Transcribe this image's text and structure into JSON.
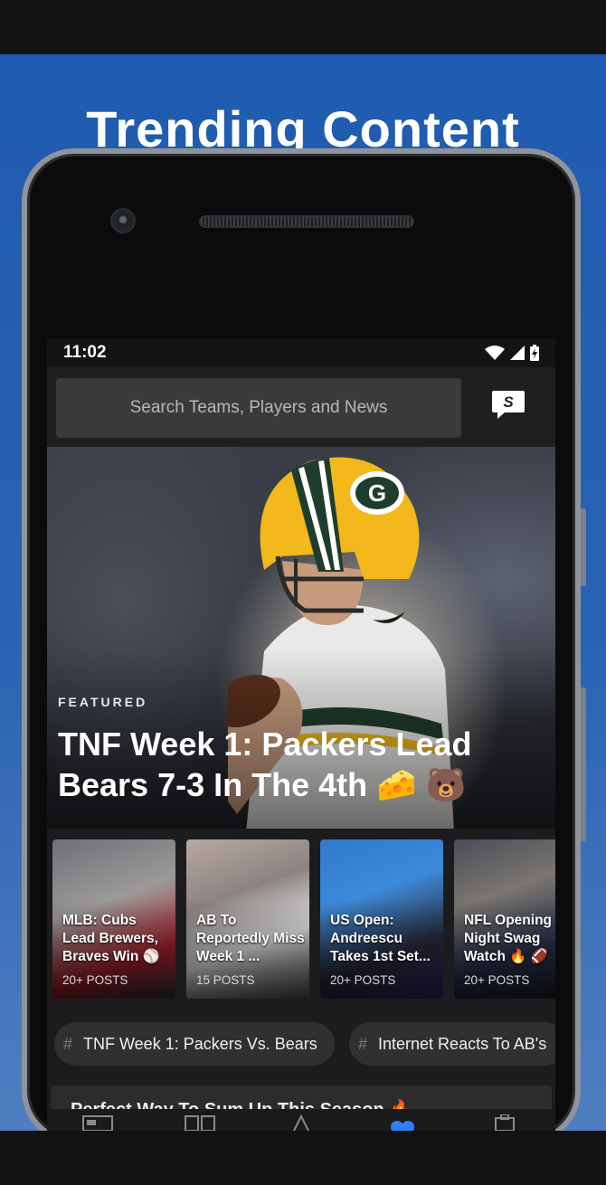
{
  "promo": {
    "title": "Trending Content"
  },
  "status_bar": {
    "time": "11:02"
  },
  "search": {
    "placeholder": "Search Teams, Players and News"
  },
  "featured": {
    "label": "FEATURED",
    "headline": "TNF Week 1: Packers Lead Bears 7-3 In The 4th 🧀 🐻"
  },
  "cards": [
    {
      "title": "MLB: Cubs Lead Brewers, Braves Win ⚾",
      "posts": "20+ POSTS"
    },
    {
      "title": "AB To Reportedly Miss Week 1 ...",
      "posts": "15 POSTS"
    },
    {
      "title": "US Open: Andreescu Takes 1st Set...",
      "posts": "20+ POSTS"
    },
    {
      "title": "NFL Opening Night Swag Watch 🔥 🏈",
      "posts": "20+ POSTS"
    }
  ],
  "chips": [
    {
      "hash": "#",
      "label": "TNF Week 1: Packers Vs. Bears"
    },
    {
      "hash": "#",
      "label": "Internet Reacts To AB's"
    }
  ],
  "list": {
    "first_title": "Perfect Way To Sum Up This Season 🔥"
  },
  "colors": {
    "promo_blue": "#1f5bb0",
    "nav_active": "#2d7ff9",
    "packers_green": "#1f3d2c",
    "packers_gold": "#f2b81c"
  }
}
